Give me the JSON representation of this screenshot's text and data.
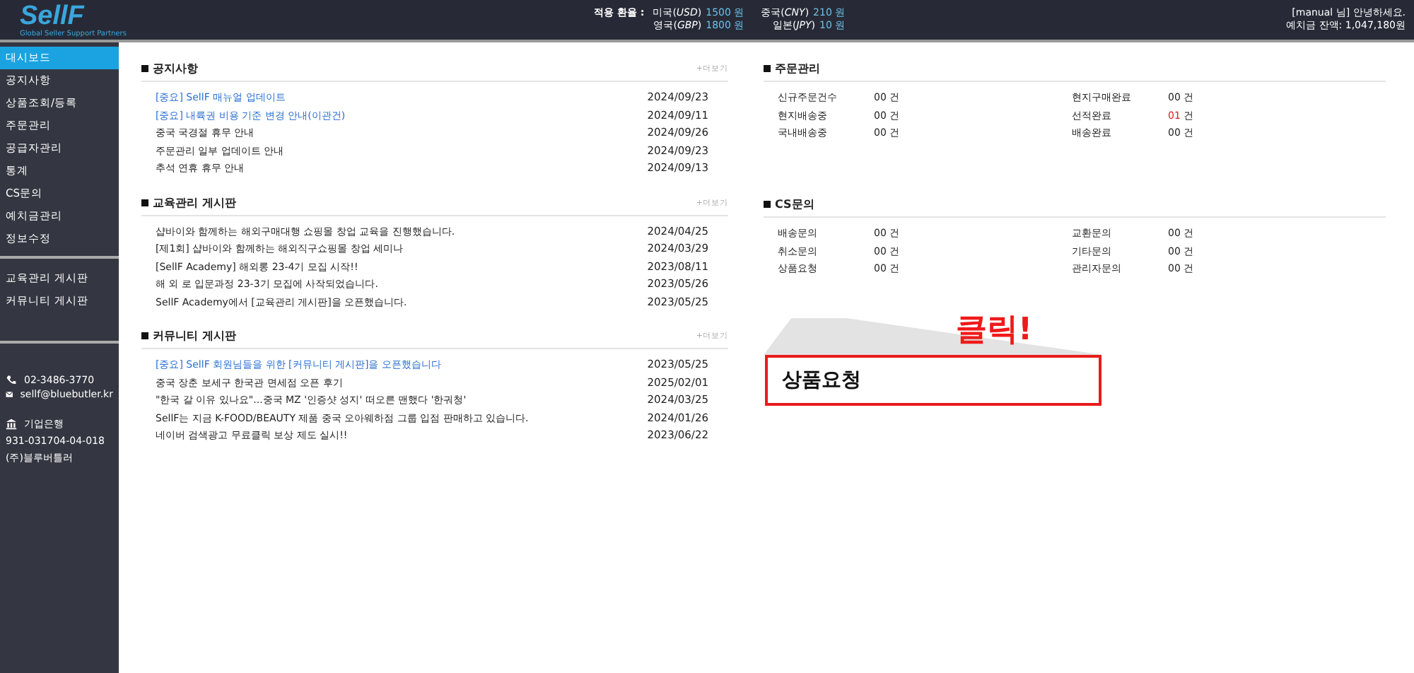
{
  "header": {
    "logo": "SellF",
    "tagline": "Global Seller Support Partners",
    "rates_label": "적용 환율 :",
    "rates": [
      {
        "country": "미국(*USD*)",
        "amount": "1500",
        "unit": "원"
      },
      {
        "country": "중국(*CNY*)",
        "amount": "210",
        "unit": "원"
      },
      {
        "country": "영국(*GBP*)",
        "amount": "1800",
        "unit": "원"
      },
      {
        "country": "일본(*JPY*)",
        "amount": "10",
        "unit": "원"
      }
    ],
    "greeting": "[manual 님] 안녕하세요.",
    "balance": "예치금 잔액: 1,047,180원"
  },
  "sidebar": {
    "groups": [
      [
        {
          "label": "대시보드",
          "selected": true
        },
        {
          "label": "공지사항",
          "selected": false
        },
        {
          "label": "상품조회/등록",
          "selected": false
        },
        {
          "label": "주문관리",
          "selected": false
        },
        {
          "label": "공급자관리",
          "selected": false
        },
        {
          "label": "통계",
          "selected": false
        },
        {
          "label": "CS문의",
          "selected": false
        },
        {
          "label": "예치금관리",
          "selected": false
        },
        {
          "label": "정보수정",
          "selected": false
        }
      ],
      [
        {
          "label": "교육관리 게시판",
          "selected": false
        },
        {
          "label": "커뮤니티 게시판",
          "selected": false
        }
      ]
    ],
    "contact": {
      "phone": "02-3486-3770",
      "email": "sellf@bluebutler.kr",
      "bank": "기업은행",
      "account": "931-031704-04-018",
      "holder": "(주)블루버틀러"
    }
  },
  "boards": [
    {
      "title": "공지사항",
      "more": "+더보기",
      "posts": [
        {
          "title": "[중요] SellF 매뉴얼 업데이트",
          "date": "2024/09/23",
          "kind": "important"
        },
        {
          "title": "[중요] 내륙권 비용 기준 변경 안내(이관건)",
          "date": "2024/09/11",
          "kind": "important"
        },
        {
          "title": "중국 국경절 휴무 안내",
          "date": "2024/09/26",
          "kind": "normal"
        },
        {
          "title": "주문관리 일부 업데이트 안내",
          "date": "2024/09/23",
          "kind": "normal"
        },
        {
          "title": "추석 연휴 휴무 안내",
          "date": "2024/09/13",
          "kind": "normal"
        }
      ]
    },
    {
      "title": "교육관리 게시판",
      "more": "+더보기",
      "posts": [
        {
          "title": "샵바이와 함께하는 해외구매대행 쇼핑몰 창업 교육을 진행했습니다.",
          "date": "2024/04/25",
          "kind": "normal"
        },
        {
          "title": "[제1회] 샵바이와 함께하는 해외직구쇼핑몰 창업 세미나",
          "date": "2024/03/29",
          "kind": "normal"
        },
        {
          "title": "[SellF Academy] 해외롱 23-4기 모집 시작!!",
          "date": "2023/08/11",
          "kind": "normal"
        },
        {
          "title": "해 외 로 입문과정 23-3기 모집에 사작되었습니다.",
          "date": "2023/05/26",
          "kind": "normal"
        },
        {
          "title": "SellF Academy에서 [교육관리 게시판]을 오픈했습니다.",
          "date": "2023/05/25",
          "kind": "normal"
        }
      ]
    },
    {
      "title": "커뮤니티 게시판",
      "more": "+더보기",
      "posts": [
        {
          "title": "[중요] SellF 회원님들을 위한 [커뮤니티 게시판]을 오픈했습니다",
          "date": "2023/05/25",
          "kind": "important"
        },
        {
          "title": "중국 장춘 보세구 한국관 면세점 오픈 후기",
          "date": "2025/02/01",
          "kind": "normal"
        },
        {
          "title": "\"한국 갈 이유 있나요\"...중국 MZ '인증샷 성지' 떠오른 맨했다 '한궈청'",
          "date": "2024/03/25",
          "kind": "normal"
        },
        {
          "title": "SellF는 지금 K-FOOD/BEAUTY 제품 중국 오아웨하점 그룹 입점 판매하고 있습니다.",
          "date": "2024/01/26",
          "kind": "normal"
        },
        {
          "title": "네이버 검색광고 무료클릭 보상 제도 실시!!",
          "date": "2023/06/22",
          "kind": "normal"
        }
      ]
    }
  ],
  "stats": [
    {
      "title": "주문관리",
      "items": [
        {
          "label": "신규주문건수",
          "value": "00",
          "unit": "건",
          "alert": false
        },
        {
          "label": "현지구매완료",
          "value": "00",
          "unit": "건",
          "alert": false
        },
        {
          "label": "현지배송중",
          "value": "00",
          "unit": "건",
          "alert": false
        },
        {
          "label": "선적완료",
          "value": "01",
          "unit": "건",
          "alert": true
        },
        {
          "label": "국내배송중",
          "value": "00",
          "unit": "건",
          "alert": false
        },
        {
          "label": "배송완료",
          "value": "00",
          "unit": "건",
          "alert": false
        }
      ]
    },
    {
      "title": "CS문의",
      "items": [
        {
          "label": "배송문의",
          "value": "00",
          "unit": "건",
          "alert": false
        },
        {
          "label": "교환문의",
          "value": "00",
          "unit": "건",
          "alert": false
        },
        {
          "label": "취소문의",
          "value": "00",
          "unit": "건",
          "alert": false
        },
        {
          "label": "기타문의",
          "value": "00",
          "unit": "건",
          "alert": false
        },
        {
          "label": "상품요청",
          "value": "00",
          "unit": "건",
          "alert": false
        },
        {
          "label": "관리자문의",
          "value": "00",
          "unit": "건",
          "alert": false
        }
      ]
    }
  ],
  "callout": {
    "label": "클릭!",
    "zoomed_text": "상품요청"
  }
}
